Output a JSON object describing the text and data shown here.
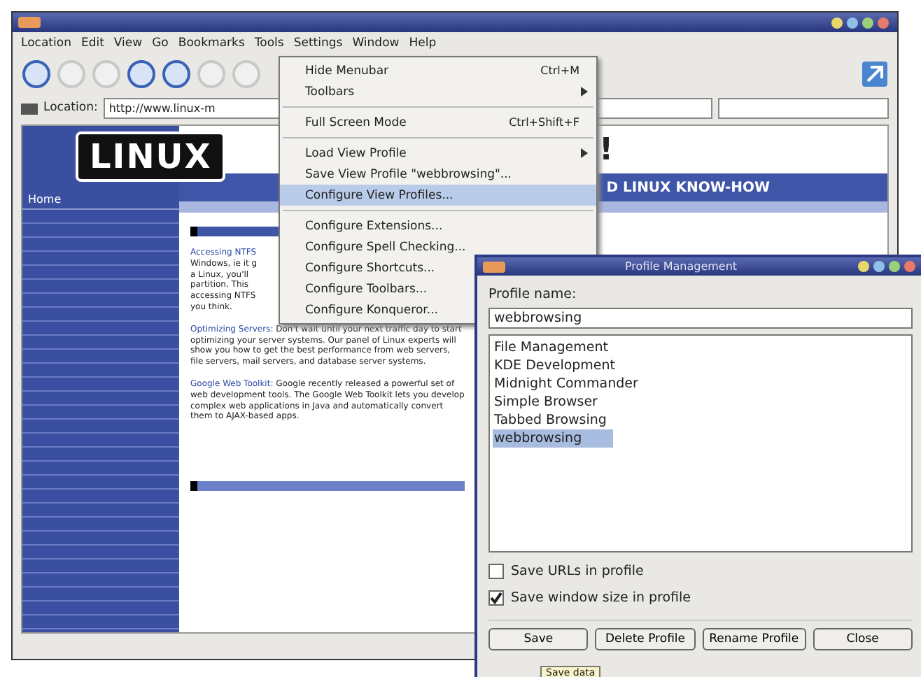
{
  "browser": {
    "menubar": [
      "Location",
      "Edit",
      "View",
      "Go",
      "Bookmarks",
      "Tools",
      "Settings",
      "Window",
      "Help"
    ],
    "location": {
      "label": "Location:",
      "url": "http://www.linux-m"
    },
    "page": {
      "logo": "LINUX",
      "header": "D LINUX KNOW-HOW",
      "exclaim": "!",
      "sidebar_title": "Home",
      "articles": [
        {
          "title": "Accessing NTFS",
          "lines": [
            "Windows, ie it g",
            "a Linux, you'll",
            "partition. This",
            "accessing NTFS",
            "you think."
          ]
        },
        {
          "title": "Optimizing Servers:",
          "body": "Don't wait until your next traffic day to start optimizing your server systems. Our panel of Linux experts will show you how to get the best performance from web servers, file servers, mail servers, and database server systems."
        },
        {
          "title": "Google Web Toolkit:",
          "body": "Google recently released a powerful set of web development tools. The Google Web Toolkit lets you develop complex web applications in Java and automatically convert them to AJAX-based apps."
        }
      ]
    }
  },
  "menu": {
    "items": [
      {
        "kind": "item",
        "label": "Hide Menubar",
        "shortcut": "Ctrl+M",
        "disabled": false,
        "selected": false
      },
      {
        "kind": "submenu",
        "label": "Toolbars",
        "disabled": false,
        "selected": false
      },
      {
        "kind": "separator"
      },
      {
        "kind": "item",
        "label": "Full Screen Mode",
        "shortcut": "Ctrl+Shift+F",
        "disabled": false,
        "selected": false
      },
      {
        "kind": "separator"
      },
      {
        "kind": "submenu",
        "label": "Load View Profile",
        "disabled": false,
        "selected": false
      },
      {
        "kind": "item",
        "label": "Save View Profile \"webbrowsing\"...",
        "disabled": false,
        "selected": false
      },
      {
        "kind": "item",
        "label": "Configure View Profiles...",
        "disabled": false,
        "selected": true
      },
      {
        "kind": "separator"
      },
      {
        "kind": "item",
        "label": "Configure Extensions...",
        "disabled": false,
        "selected": false
      },
      {
        "kind": "item",
        "label": "Configure Spell Checking...",
        "disabled": false,
        "selected": false
      },
      {
        "kind": "item",
        "label": "Configure Shortcuts...",
        "disabled": false,
        "selected": false
      },
      {
        "kind": "item",
        "label": "Configure Toolbars...",
        "disabled": false,
        "selected": false
      },
      {
        "kind": "item",
        "label": "Configure Konqueror...",
        "disabled": false,
        "selected": false
      }
    ]
  },
  "dialog": {
    "title": "Profile Management",
    "name_label": "Profile name:",
    "name_value": "webbrowsing",
    "profiles": [
      {
        "label": "File Management",
        "selected": false
      },
      {
        "label": "KDE Development",
        "selected": false
      },
      {
        "label": "Midnight Commander",
        "selected": false
      },
      {
        "label": "Simple Browser",
        "selected": false
      },
      {
        "label": "Tabbed Browsing",
        "selected": false
      },
      {
        "label": "webbrowsing",
        "selected": true
      }
    ],
    "options": [
      {
        "label": "Save URLs in profile",
        "checked": false
      },
      {
        "label": "Save window size in profile",
        "checked": true
      }
    ],
    "buttons": [
      "Save",
      "Delete Profile",
      "Rename Profile",
      "Close"
    ],
    "tooltip": "Save data"
  }
}
